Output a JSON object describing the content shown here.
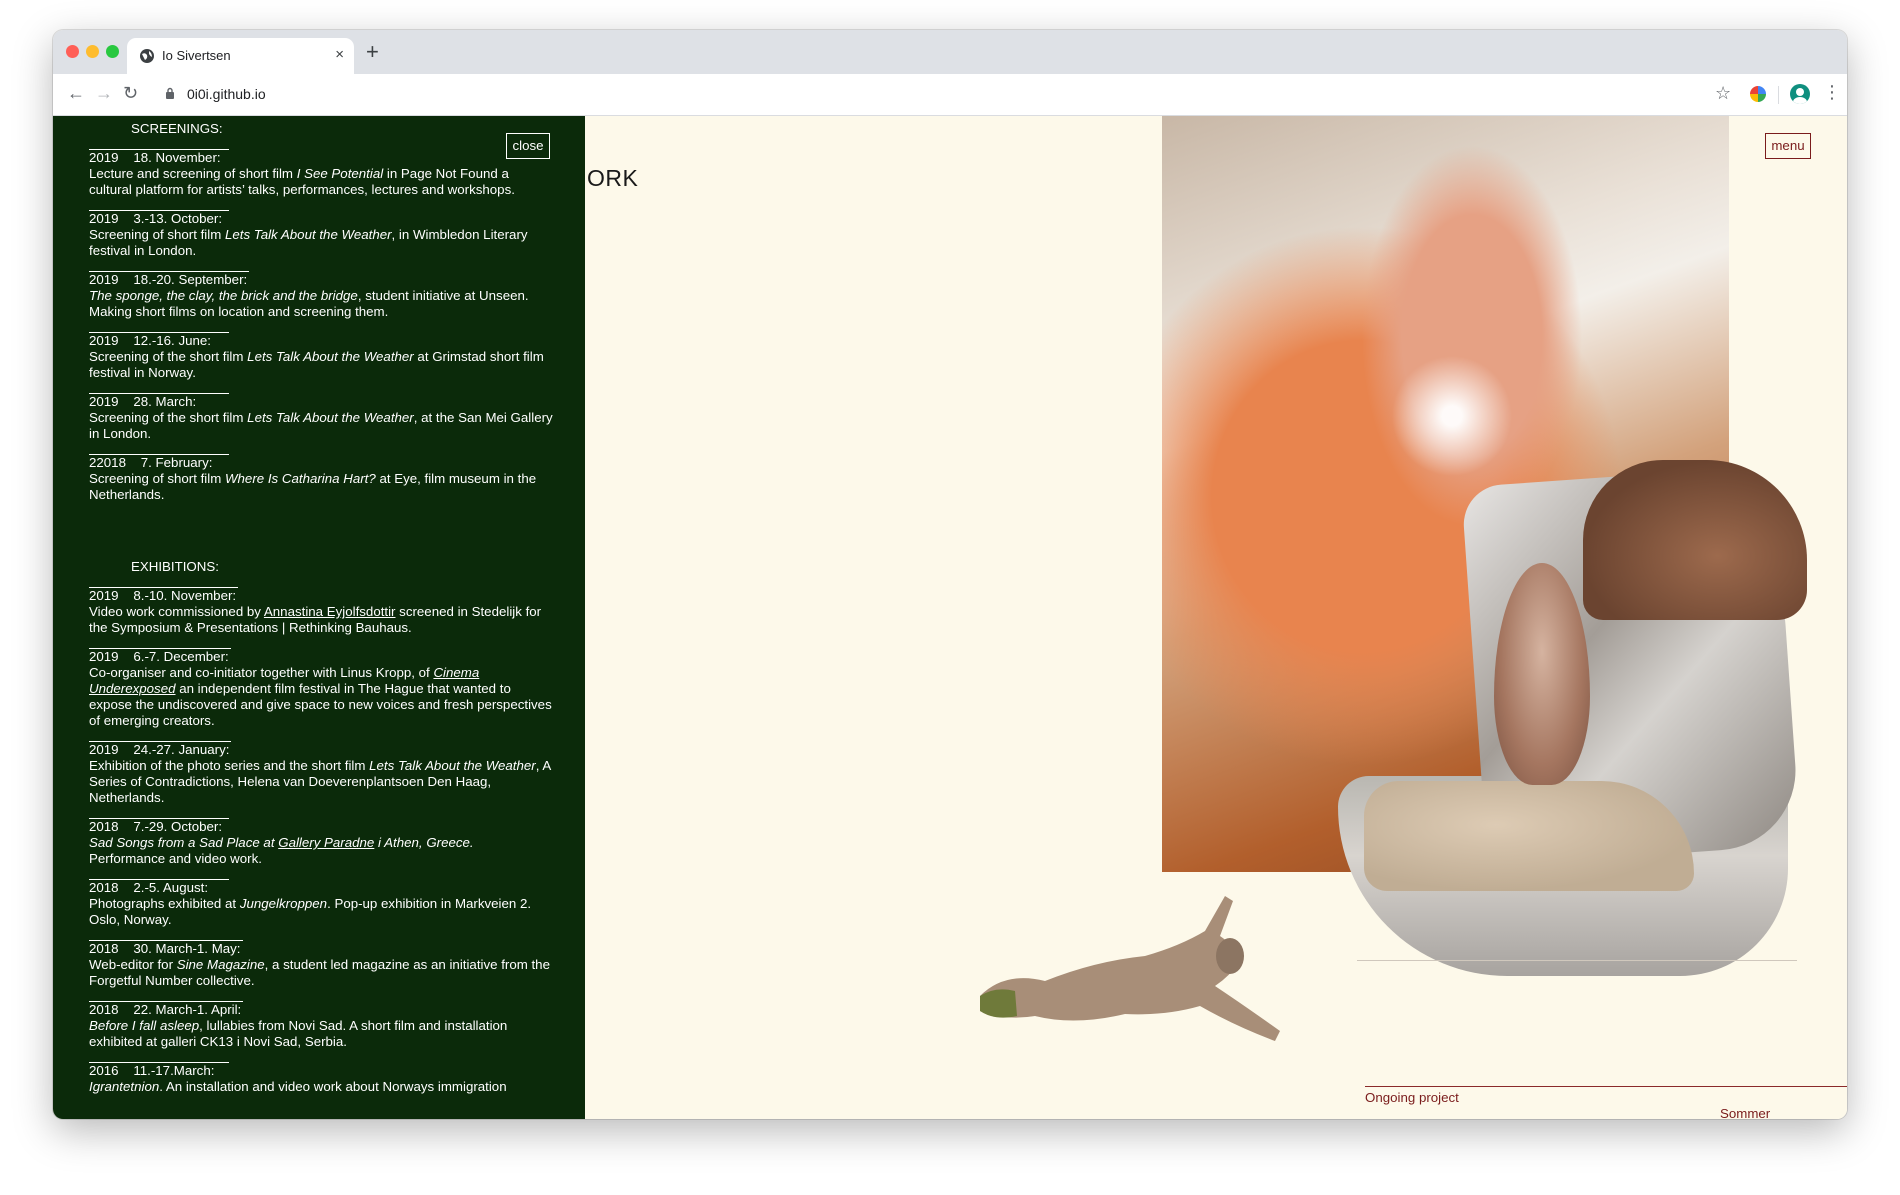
{
  "browser": {
    "tab_title": "Io Sivertsen",
    "tab_close": "×",
    "new_tab": "+",
    "url": "0i0i.github.io",
    "back": "←",
    "forward": "→",
    "reload": "↻",
    "star": "☆",
    "menu": "⋮"
  },
  "panel": {
    "close_label": "close",
    "screenings_heading": "SCREENINGS:",
    "exhibitions_heading": "EXHIBITIONS:",
    "screenings": [
      {
        "date": "2019    18. November:",
        "desc_html": "Lecture and screening of short film <em>I See Potential</em> in Page Not Found a cultural platform for artists’ talks, performances, lectures and workshops."
      },
      {
        "date": "2019    3.-13. October:",
        "desc_html": "Screening of short film <em>Lets Talk About the Weather</em>, in Wimbledon Literary festival in London."
      },
      {
        "date": "2019    18.-20. September:",
        "desc_html": "<em>The sponge, the clay, the brick and the bridge</em>, student initiative at Unseen. Making short films on location and screening them."
      },
      {
        "date": "2019    12.-16. June:",
        "desc_html": "Screening of the short film <em>Lets Talk About the Weather</em> at Grimstad short film festival in Norway."
      },
      {
        "date": "2019    28. March:",
        "desc_html": "Screening of the short film <em>Lets Talk About the Weather</em>, at the San Mei Gallery in London."
      },
      {
        "date": "22018    7. February:",
        "desc_html": "Screening of short film <em>Where Is Catharina Hart?</em> at Eye, film museum in the Netherlands."
      }
    ],
    "exhibitions": [
      {
        "date": "2019    8.-10. November:",
        "desc_html": "Video work commissioned by <a>Annastina Eyjolfsdottir</a> screened in Stedelijk for the Symposium &amp; Presentations | Rethinking Bauhaus."
      },
      {
        "date": "2019    6.-7. December:",
        "desc_html": "Co-organiser and co-initiator together with Linus Kropp, of <em><a>Cinema Underexposed</a></em> an independent film festival in The Hague that wanted to expose the undiscovered and give space to new voices and fresh perspectives of emerging creators."
      },
      {
        "date": "2019    24.-27. January:",
        "desc_html": "Exhibition of the photo series and the short film <em>Lets Talk About the Weather</em>, A Series of Contradictions, Helena van Doeverenplantsoen Den Haag, Netherlands."
      },
      {
        "date": "2018    7.-29. October:",
        "desc_html": "<em>Sad Songs from a Sad Place at <a>Gallery Paradne</a> i Athen, Greece.</em> Performance and video work."
      },
      {
        "date": "2018    2.-5. August:",
        "desc_html": "Photographs exhibited at <em>Jungelkroppen</em>. Pop-up exhibition in Markveien 2. Oslo, Norway."
      },
      {
        "date": "2018    30. March-1. May:",
        "desc_html": "Web-editor for <em>Sine Magazine</em>, a student led magazine as an initiative from the Forgetful Number collective."
      },
      {
        "date": "2018    22. March-1. April:",
        "desc_html": "<em>Before I fall asleep</em>, lullabies from Novi Sad. A short film and installation exhibited at galleri CK13 i Novi Sad, Serbia."
      },
      {
        "date": "2016    11.-17.March:",
        "desc_html": "<em>Igrantetnion</em>. An installation and video work about Norways immigration"
      }
    ]
  },
  "main": {
    "heading_fragment": "ORK",
    "menu_label": "menu",
    "ongoing_label": "Ongoing project",
    "sommer_label": "Sommer"
  }
}
